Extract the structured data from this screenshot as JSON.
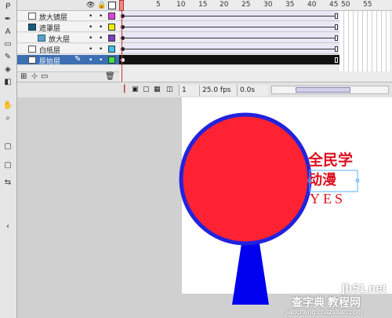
{
  "timeline": {
    "ruler_numbers": [
      "5",
      "10",
      "15",
      "20",
      "25",
      "30",
      "35",
      "40",
      "45",
      "50",
      "55"
    ],
    "header_icons": [
      "eye-icon",
      "lock-icon",
      "outline-icon"
    ],
    "layers": [
      {
        "name": "放大镜层",
        "type": "normal",
        "color": "#e040e0",
        "frames": "tween"
      },
      {
        "name": "遮罩层",
        "type": "mask",
        "color": "#f0f000",
        "frames": "tween"
      },
      {
        "name": "放大层",
        "type": "masked",
        "color": "#8040c0",
        "frames": "tween"
      },
      {
        "name": "白纸层",
        "type": "normal",
        "color": "#40c0f0",
        "frames": "tween"
      },
      {
        "name": "原始层",
        "type": "normal",
        "color": "#40e040",
        "frames": "black",
        "selected": true
      }
    ],
    "status": {
      "frame": "1",
      "fps": "25.0 fps",
      "time": "0.0s"
    }
  },
  "stage": {
    "circle_color": "#ff2233",
    "circle_stroke": "#2222dd",
    "handle_color": "#0000ee",
    "text_color": "#dd1122",
    "line1": "全民学",
    "line2": "动漫",
    "line3": "YES",
    "watermark1": "jb51.net",
    "watermark2": "查字典 教程网",
    "watermark3": "jiaocheng.chazidian.com"
  }
}
